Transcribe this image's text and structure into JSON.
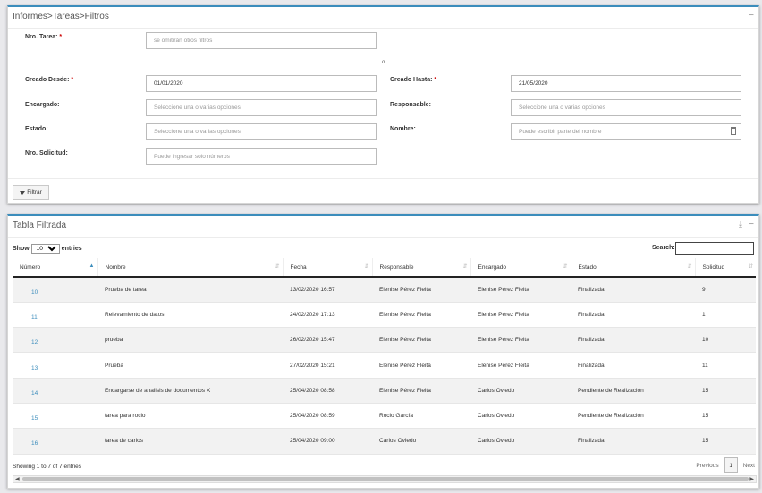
{
  "filters_panel": {
    "title": "Informes>Tareas>Filtros",
    "collapse": "−",
    "nro_tarea": {
      "label": "Nro. Tarea:",
      "value": "",
      "placeholder": "se omitirán otros filtros"
    },
    "separator": "o",
    "creado_desde": {
      "label": "Creado Desde:",
      "value": "01/01/2020"
    },
    "creado_hasta": {
      "label": "Creado Hasta:",
      "value": "21/05/2020"
    },
    "encargado": {
      "label": "Encargado:",
      "placeholder": "Seleccione una o varias opciones"
    },
    "responsable": {
      "label": "Responsable:",
      "placeholder": "Seleccione una o varias opciones"
    },
    "estado": {
      "label": "Estado:",
      "placeholder": "Seleccione una o varias opciones"
    },
    "nombre": {
      "label": "Nombre:",
      "placeholder": "Puede escribir parte del nombre"
    },
    "nro_solicitud": {
      "label": "Nro. Solicitud:",
      "placeholder": "Puede ingresar solo números"
    },
    "filter_button": "Filtrar",
    "required_mark": "*"
  },
  "table_panel": {
    "title": "Tabla Filtrada",
    "collapse": "−",
    "download": "⤓",
    "show_label": "Show",
    "entries_label": "entries",
    "page_size": "10",
    "search_label": "Search:",
    "search_value": "",
    "columns": [
      "Número",
      "Nombre",
      "Fecha",
      "Responsable",
      "Encargado",
      "Estado",
      "Solicitud"
    ],
    "rows": [
      [
        "10",
        "Prueba de tarea",
        "13/02/2020 16:57",
        "Elenise Pérez Fleita",
        "Elenise Pérez Fleita",
        "Finalizada",
        "9"
      ],
      [
        "11",
        "Relevamiento de datos",
        "24/02/2020 17:13",
        "Elenise Pérez Fleita",
        "Elenise Pérez Fleita",
        "Finalizada",
        "1"
      ],
      [
        "12",
        "prueba",
        "26/02/2020 15:47",
        "Elenise Pérez Fleita",
        "Elenise Pérez Fleita",
        "Finalizada",
        "10"
      ],
      [
        "13",
        "Prueba",
        "27/02/2020 15:21",
        "Elenise Pérez Fleita",
        "Elenise Pérez Fleita",
        "Finalizada",
        "11"
      ],
      [
        "14",
        "Encargarse de analisis de documentos X",
        "25/04/2020 08:58",
        "Elenise Pérez Fleita",
        "Carlos Oviedo",
        "Pendiente de Realización",
        "15"
      ],
      [
        "15",
        "tarea para rocio",
        "25/04/2020 08:59",
        "Rocio García",
        "Carlos Oviedo",
        "Pendiente de Realización",
        "15"
      ],
      [
        "16",
        "tarea de carlos",
        "25/04/2020 09:00",
        "Carlos Oviedo",
        "Carlos Oviedo",
        "Finalizada",
        "15"
      ]
    ],
    "info": "Showing 1 to 7 of 7 entries",
    "pagination": {
      "previous": "Previous",
      "page": "1",
      "next": "Next"
    }
  }
}
